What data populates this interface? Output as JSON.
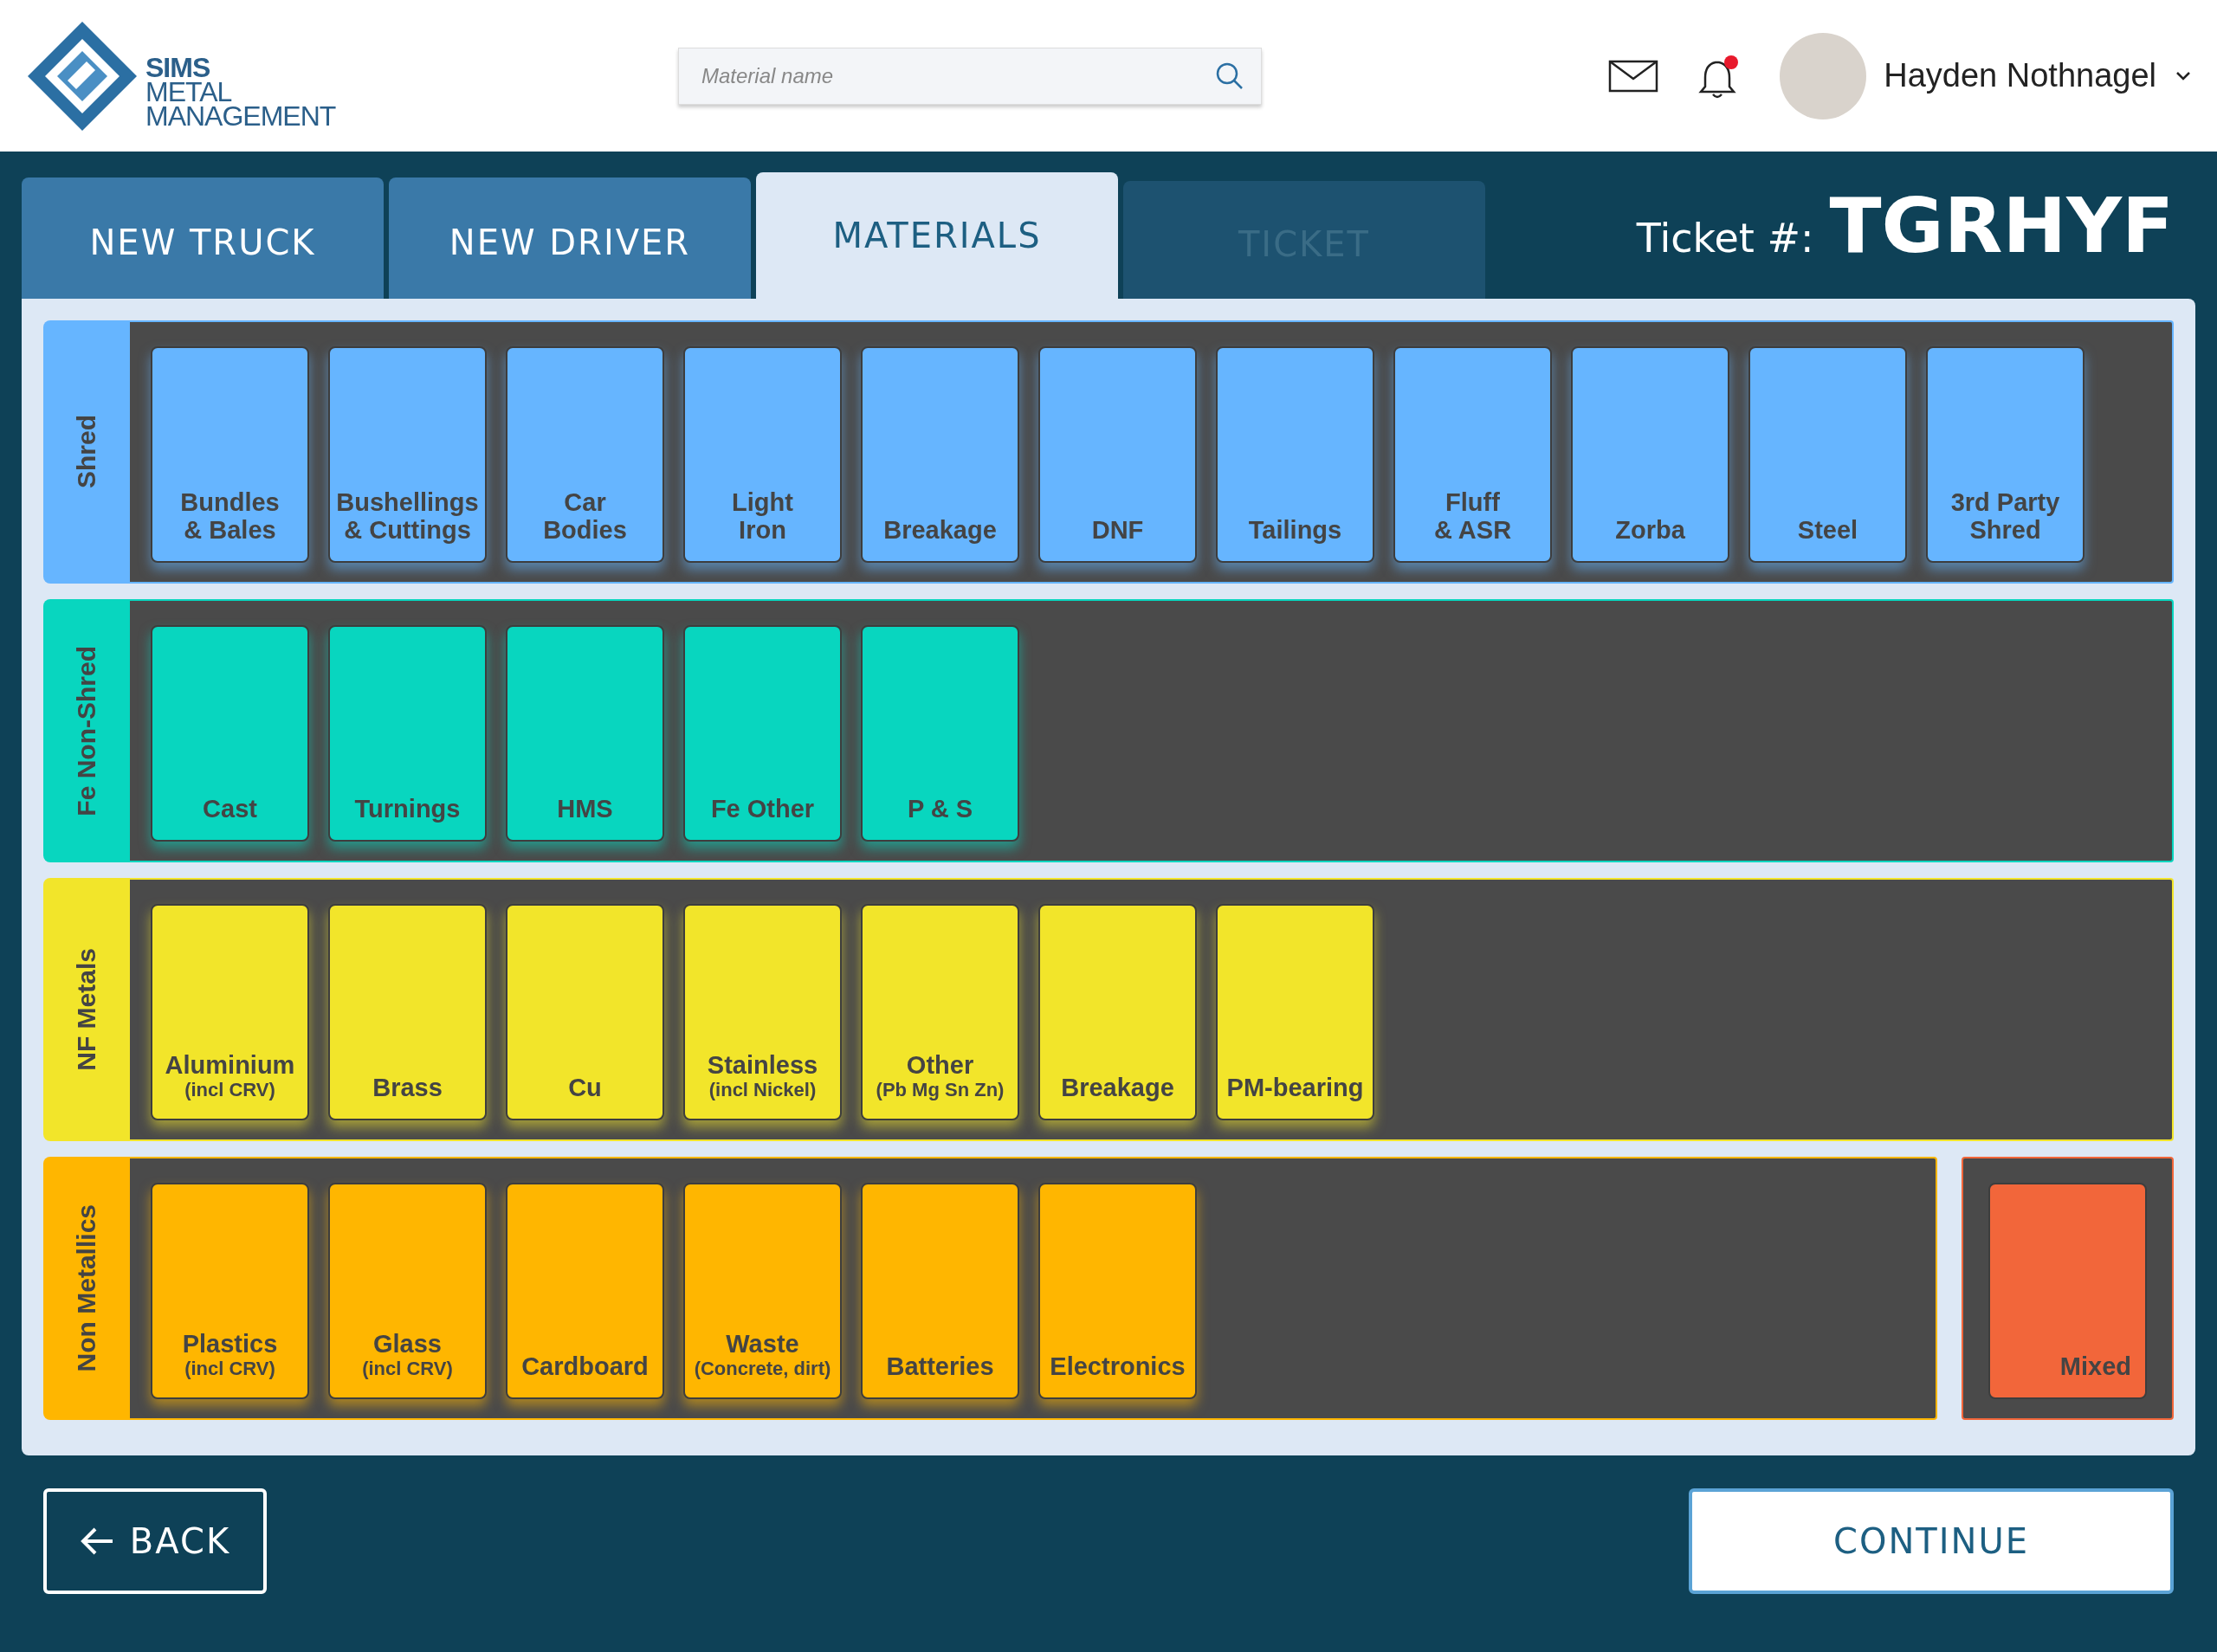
{
  "header": {
    "logo": {
      "lines": [
        "SIMS",
        "METAL",
        "MANAGEMENT"
      ]
    },
    "search": {
      "placeholder": "Material name"
    },
    "notification_unread": true,
    "user": {
      "name": "Hayden Nothnagel"
    }
  },
  "tabs": [
    {
      "label": "NEW TRUCK",
      "selected": false,
      "disabled": false
    },
    {
      "label": "NEW DRIVER",
      "selected": false,
      "disabled": false
    },
    {
      "label": "MATERIALS",
      "selected": true,
      "disabled": false
    },
    {
      "label": "TICKET",
      "selected": false,
      "disabled": true
    }
  ],
  "ticket": {
    "label": "Ticket #:",
    "number": "TGRHYF"
  },
  "categories": [
    {
      "name": "Shred",
      "color": "#66b5ff",
      "materials": [
        {
          "lines": [
            "Bundles",
            "& Bales"
          ]
        },
        {
          "lines": [
            "Bushellings",
            "& Cuttings"
          ]
        },
        {
          "lines": [
            "Car",
            "Bodies"
          ]
        },
        {
          "lines": [
            "Light",
            "Iron"
          ]
        },
        {
          "lines": [
            "Breakage"
          ]
        },
        {
          "lines": [
            "DNF"
          ]
        },
        {
          "lines": [
            "Tailings"
          ]
        },
        {
          "lines": [
            "Fluff",
            "& ASR"
          ]
        },
        {
          "lines": [
            "Zorba"
          ]
        },
        {
          "lines": [
            "Steel"
          ]
        },
        {
          "lines": [
            "3rd Party",
            "Shred"
          ]
        }
      ]
    },
    {
      "name": "Fe Non-Shred",
      "color": "#08d6bf",
      "materials": [
        {
          "lines": [
            "Cast"
          ]
        },
        {
          "lines": [
            "Turnings"
          ]
        },
        {
          "lines": [
            "HMS"
          ]
        },
        {
          "lines": [
            "Fe Other"
          ]
        },
        {
          "lines": [
            "P & S"
          ]
        }
      ]
    },
    {
      "name": "NF Metals",
      "color": "#f2e52a",
      "materials": [
        {
          "lines": [
            "Aluminium"
          ],
          "sub": "(incl CRV)"
        },
        {
          "lines": [
            "Brass"
          ]
        },
        {
          "lines": [
            "Cu"
          ]
        },
        {
          "lines": [
            "Stainless"
          ],
          "sub": "(incl Nickel)"
        },
        {
          "lines": [
            "Other"
          ],
          "sub": "(Pb Mg Sn Zn)"
        },
        {
          "lines": [
            "Breakage"
          ]
        },
        {
          "lines": [
            "PM-bearing"
          ]
        }
      ]
    },
    {
      "name": "Non Metallics",
      "color": "#ffb600",
      "materials": [
        {
          "lines": [
            "Plastics"
          ],
          "sub": "(incl CRV)"
        },
        {
          "lines": [
            "Glass"
          ],
          "sub": "(incl CRV)"
        },
        {
          "lines": [
            "Cardboard"
          ]
        },
        {
          "lines": [
            "Waste"
          ],
          "sub": "(Concrete, dirt)"
        },
        {
          "lines": [
            "Batteries"
          ]
        },
        {
          "lines": [
            "Electronics"
          ]
        }
      ],
      "extra": {
        "lines": [
          "Mixed"
        ],
        "color": "#f2663a"
      }
    }
  ],
  "back_button": {
    "label": "BACK"
  },
  "continue_button": {
    "label": "CONTINUE"
  }
}
